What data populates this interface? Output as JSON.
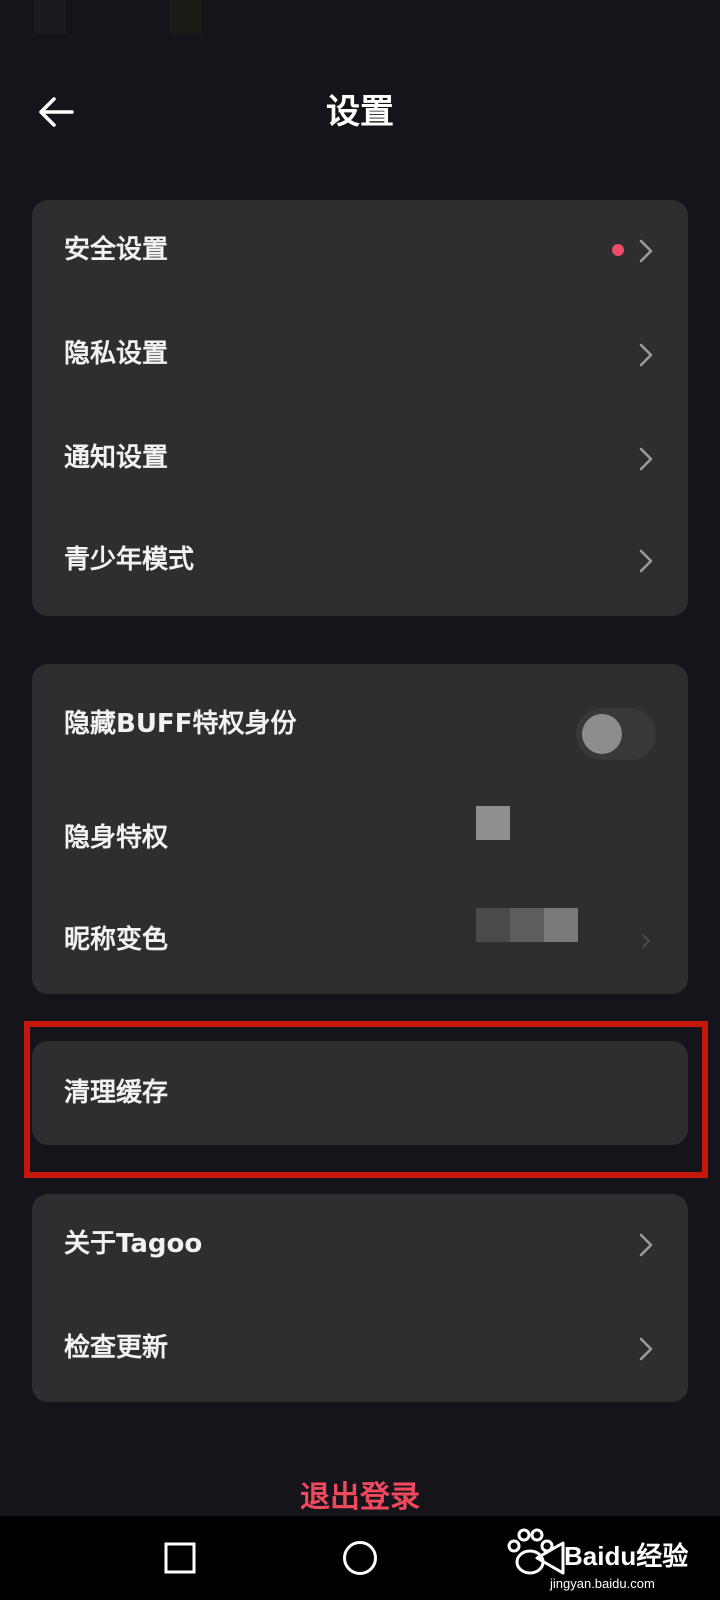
{
  "header": {
    "title": "设置"
  },
  "group1": {
    "items": [
      {
        "label": "安全设置",
        "has_dot": true
      },
      {
        "label": "隐私设置"
      },
      {
        "label": "通知设置"
      },
      {
        "label": "青少年模式"
      }
    ]
  },
  "group2": {
    "items": [
      {
        "label": "隐藏BUFF特权身份",
        "toggle_on": false
      },
      {
        "label": "隐身特权"
      },
      {
        "label": "昵称变色"
      }
    ]
  },
  "group3": {
    "items": [
      {
        "label": "清理缓存"
      }
    ]
  },
  "group4": {
    "items": [
      {
        "label": "关于Tagoo"
      },
      {
        "label": "检查更新"
      }
    ]
  },
  "logout": {
    "label": "退出登录"
  },
  "watermark": {
    "text": "Baidu经验",
    "sub": "jingyan.baidu.com"
  },
  "colors": {
    "background": "#15141a",
    "card": "#2e2e30",
    "accent_red": "#f0485c",
    "dot": "#ee4d67",
    "highlight_border": "#c6170e"
  },
  "icons": [
    "back-arrow-icon",
    "chevron-right-icon",
    "recent-apps-icon",
    "home-icon",
    "back-icon",
    "baidu-paw-icon"
  ]
}
